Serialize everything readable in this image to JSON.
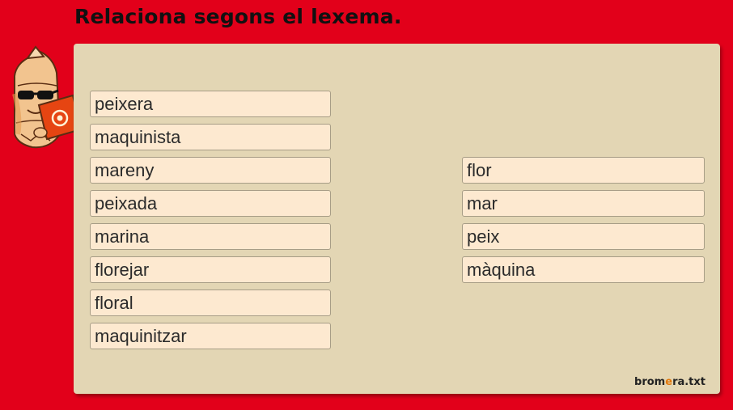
{
  "header": {
    "title": "Relaciona segons el lexema."
  },
  "left_words": [
    "peixera",
    "maquinista",
    "mareny",
    "peixada",
    "marina",
    "florejar",
    "floral",
    "maquinitzar"
  ],
  "right_words": [
    "flor",
    "mar",
    "peix",
    "màquina"
  ],
  "footer": {
    "brand_prefix": "brom",
    "brand_accent": "e",
    "brand_suffix": "ra.txt"
  },
  "colors": {
    "background": "#e2001a",
    "panel": "#e3d6b4",
    "word_box": "#fde9d0",
    "brand_accent": "#e2780a"
  },
  "icons": {
    "mascot": "reading-pencil-mascot-icon"
  }
}
